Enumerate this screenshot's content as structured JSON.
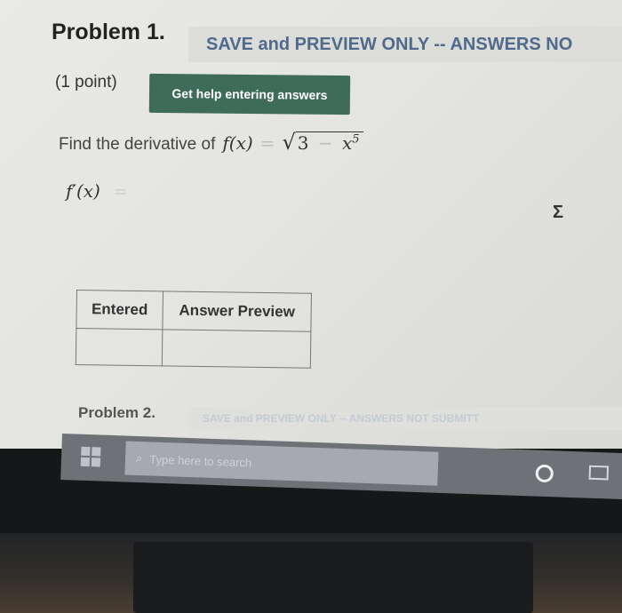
{
  "problem": {
    "title": "Problem 1.",
    "save_banner": "SAVE and PREVIEW ONLY -- ANSWERS NO",
    "points": "(1 point)",
    "help_button": "Get help entering answers",
    "question_text": "Find the derivative of",
    "function_lhs": "f(x)",
    "equals": "=",
    "radical_symbol": "√",
    "radicand_const": "3",
    "radicand_minus": "−",
    "radicand_var": "x",
    "radicand_exp": "5",
    "answer_label": "f′(x)",
    "answer_equals": "=",
    "answer_value": "",
    "equation_editor_icon": "Σ"
  },
  "preview_table": {
    "headers": [
      "Entered",
      "Answer Preview"
    ],
    "row": [
      "",
      ""
    ]
  },
  "problem2": {
    "title": "Problem 2.",
    "save_banner": "SAVE and PREVIEW ONLY -- ANSWERS NOT SUBMITT"
  },
  "taskbar": {
    "search_placeholder": "Type here to search",
    "icons": [
      "windows-start-icon",
      "search-icon",
      "cortana-icon",
      "task-view-icon"
    ]
  },
  "colors": {
    "help_button_bg": "#3f6c5a",
    "banner_text": "#4f6a8c",
    "taskbar": "#6e7277"
  }
}
